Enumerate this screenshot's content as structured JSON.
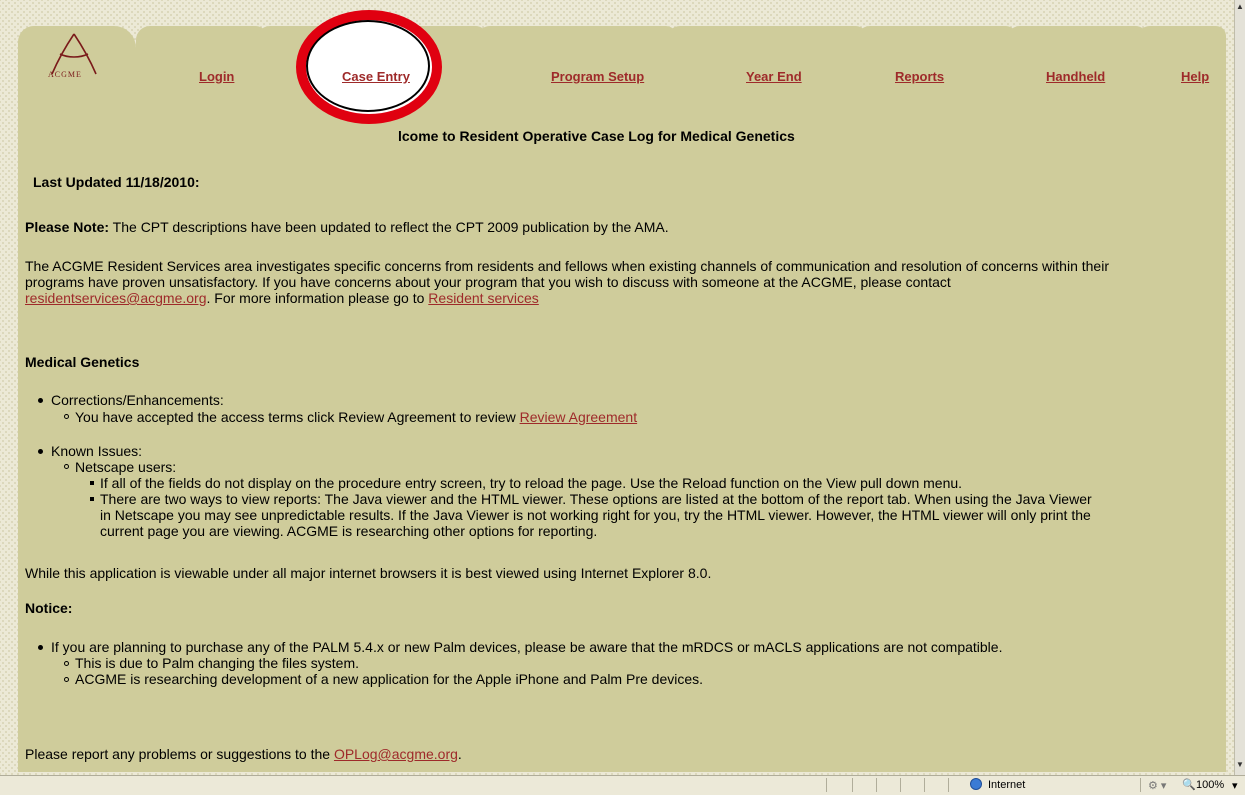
{
  "nav": {
    "logo_text": "ACGME",
    "tabs": [
      "Login",
      "Case Entry",
      "Program Setup",
      "Year End",
      "Reports",
      "Handheld",
      "Help"
    ]
  },
  "page": {
    "heading": "Welcome to Resident Operative Case Log for Medical Genetics",
    "heading_visible": "lcome to Resident Operative Case Log for Medical Genetics",
    "last_updated": "Last Updated 11/18/2010:",
    "note_label": "Please Note:",
    "note_text": " The CPT descriptions have been updated to reflect the CPT 2009 publication by the AMA.",
    "services_line1": "The ACGME Resident Services area investigates specific concerns from residents and fellows when existing channels of communication and resolution of concerns within their",
    "services_line2": "programs have proven unsatisfactory. If you have concerns about your program that you wish to discuss with someone at the ACGME, please contact",
    "services_email": "residentservices@acgme.org",
    "services_more": ". For more information please go to ",
    "services_link": "Resident services",
    "section_title": "Medical Genetics",
    "corrections_label": "Corrections/Enhancements:",
    "agreement_text": "You have accepted the access terms click Review Agreement to review ",
    "agreement_link": "Review Agreement",
    "known_issues_label": "Known Issues:",
    "netscape_label": "Netscape users:",
    "issue1": "If all of the fields do not display on the procedure entry screen, try to reload the page. Use the Reload function on the View pull down menu.",
    "issue2_line1": "There are two ways to view reports: The Java viewer and the HTML viewer. These options are listed at the bottom of the report tab. When using the Java Viewer",
    "issue2_line2": "in Netscape you may see unpredictable results. If the Java Viewer is not working right for you, try the HTML viewer. However, the HTML viewer will only print the",
    "issue2_line3": "current page you are viewing. ACGME is researching other options for reporting.",
    "browser_note": "While this application is viewable under all major internet browsers it is best viewed using Internet Explorer 8.0.",
    "notice_title": "Notice:",
    "palm_note": "If you are planning to purchase any of the PALM 5.4.x or new Palm devices, please be aware that the mRDCS or mACLS applications are not compatible.",
    "palm_sub1": "This is due to Palm changing the files system.",
    "palm_sub2": "ACGME is researching development of a new application for the Apple iPhone and Palm Pre devices.",
    "report_text": "Please report any problems or suggestions to the ",
    "report_link": "OPLog@acgme.org",
    "report_end": "."
  },
  "statusbar": {
    "zone": "Internet",
    "zoom": "100%"
  },
  "colors": {
    "panel": "#cfcc9b",
    "link": "#9e2a2a",
    "annotation_circle": "#e00010"
  }
}
